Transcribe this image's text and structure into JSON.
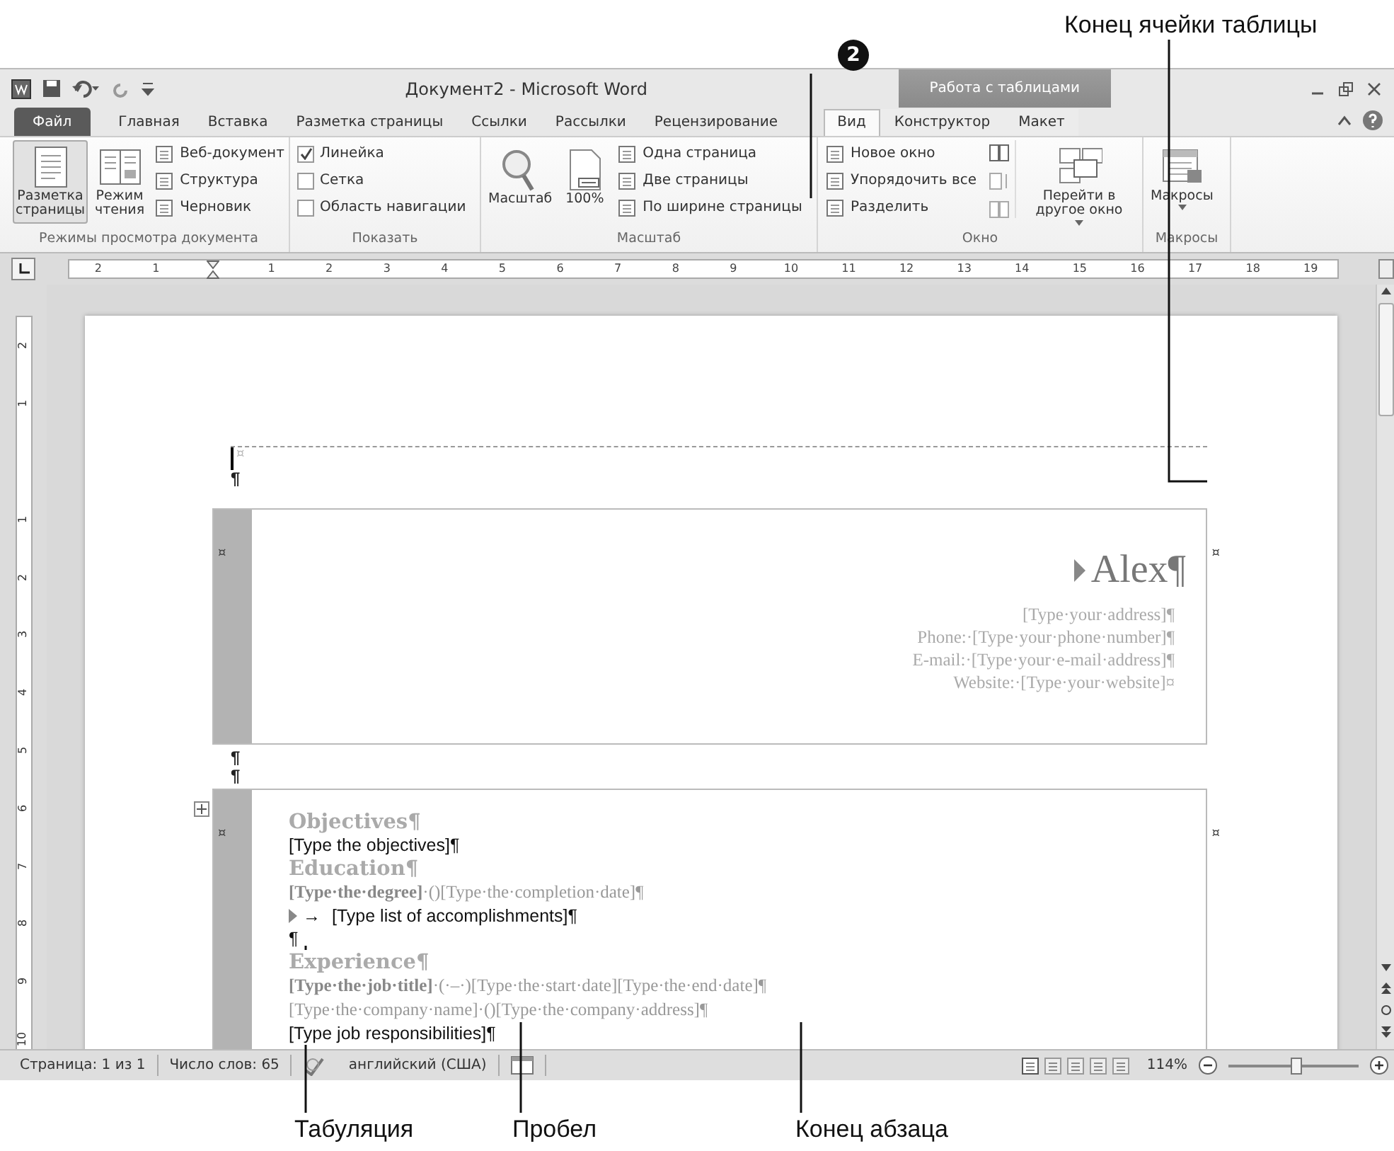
{
  "annotations": {
    "top_label": "Конец ячейки таблицы",
    "badge": "2",
    "bottom_labels": [
      "Табуляция",
      "Пробел",
      "Конец абзаца"
    ]
  },
  "window": {
    "title": "Документ2 - Microsoft Word",
    "context_title": "Работа с таблицами"
  },
  "tabs": [
    {
      "label": "Файл",
      "kind": "file",
      "selected": false
    },
    {
      "label": "Главная",
      "kind": "tab",
      "selected": false
    },
    {
      "label": "Вставка",
      "kind": "tab",
      "selected": false
    },
    {
      "label": "Разметка страницы",
      "kind": "tab",
      "selected": false
    },
    {
      "label": "Ссылки",
      "kind": "tab",
      "selected": false
    },
    {
      "label": "Рассылки",
      "kind": "tab",
      "selected": false
    },
    {
      "label": "Рецензирование",
      "kind": "tab",
      "selected": false
    },
    {
      "label": "Вид",
      "kind": "tab",
      "selected": true
    },
    {
      "label": "Конструктор",
      "kind": "context",
      "selected": false
    },
    {
      "label": "Макет",
      "kind": "context",
      "selected": false
    }
  ],
  "ribbon": {
    "groups": [
      {
        "label": "Режимы просмотра документа",
        "items": [
          {
            "kind": "big",
            "label": "Разметка страницы",
            "selected": true
          },
          {
            "kind": "big",
            "label": "Режим чтения",
            "selected": false
          },
          {
            "kind": "stack",
            "items": [
              {
                "label": "Веб-документ"
              },
              {
                "label": "Структура"
              },
              {
                "label": "Черновик"
              }
            ]
          }
        ]
      },
      {
        "label": "Показать",
        "items": [
          {
            "kind": "checks",
            "items": [
              {
                "label": "Линейка",
                "checked": true
              },
              {
                "label": "Сетка",
                "checked": false
              },
              {
                "label": "Область навигации",
                "checked": false
              }
            ]
          }
        ]
      },
      {
        "label": "Масштаб",
        "items": [
          {
            "kind": "big",
            "label": "Масштаб"
          },
          {
            "kind": "big",
            "label": "100%"
          },
          {
            "kind": "stack",
            "items": [
              {
                "label": "Одна страница"
              },
              {
                "label": "Две страницы"
              },
              {
                "label": "По ширине страницы"
              }
            ]
          }
        ]
      },
      {
        "label": "Окно",
        "items": [
          {
            "kind": "stack",
            "items": [
              {
                "label": "Новое окно"
              },
              {
                "label": "Упорядочить все"
              },
              {
                "label": "Разделить"
              }
            ]
          },
          {
            "kind": "iconstack"
          },
          {
            "kind": "big",
            "label": "Перейти в другое окно",
            "dropdown": true
          }
        ]
      },
      {
        "label": "Макросы",
        "items": [
          {
            "kind": "big",
            "label": "Макросы",
            "dropdown": true
          }
        ]
      }
    ]
  },
  "ruler": {
    "left_labels": [
      "2",
      "1"
    ],
    "labels": [
      "1",
      "2",
      "3",
      "4",
      "5",
      "6",
      "7",
      "8",
      "9",
      "10",
      "11",
      "12",
      "13",
      "14",
      "15",
      "16",
      "17",
      "18",
      "19"
    ]
  },
  "vertical_ruler": {
    "left_labels": [
      "2",
      "1"
    ],
    "labels": [
      "1",
      "2",
      "3",
      "4",
      "5",
      "6",
      "7",
      "8",
      "9",
      "10"
    ]
  },
  "document": {
    "top_cell_mark": "¤",
    "top_mark": "¶",
    "header_table": {
      "left_mark": "¤",
      "right_mark": "¤",
      "name": "Alex¶",
      "lines": [
        "[Type·your·address]¶",
        "Phone:·[Type·your·phone·number]¶",
        "E-mail:·[Type·your·e-mail·address]¶",
        "Website:·[Type·your·website]¤"
      ]
    },
    "between_marks": [
      "¶",
      "¶"
    ],
    "body_table": {
      "left_mark": "¤",
      "right_mark": "¤",
      "paragraphs": [
        {
          "kind": "heading",
          "text": "Objectives¶"
        },
        {
          "kind": "body",
          "text": "[Type the objectives]¶"
        },
        {
          "kind": "heading",
          "text": "Education¶"
        },
        {
          "kind": "field",
          "text": "**[Type·the·degree]**·()[Type·the·completion·date]¶"
        },
        {
          "kind": "bullet",
          "mark": "→",
          "text": "[Type list of accomplishments]¶"
        },
        {
          "kind": "body",
          "text": "¶"
        },
        {
          "kind": "heading",
          "text": "Experience¶"
        },
        {
          "kind": "field",
          "text": "**[Type·the·job·title]**·(·–·)[Type·the·start·date][Type·the·end·date]¶"
        },
        {
          "kind": "field",
          "text": "[Type·the·company·name]·()[Type·the·company·address]¶"
        },
        {
          "kind": "body",
          "text": "[Type job responsibilities]¶"
        }
      ]
    }
  },
  "status_bar": {
    "page": "Страница: 1 из 1",
    "words": "Число слов: 65",
    "language": "английский (США)",
    "zoom": "114%",
    "zoom_slider": {
      "level": 0.52
    }
  }
}
